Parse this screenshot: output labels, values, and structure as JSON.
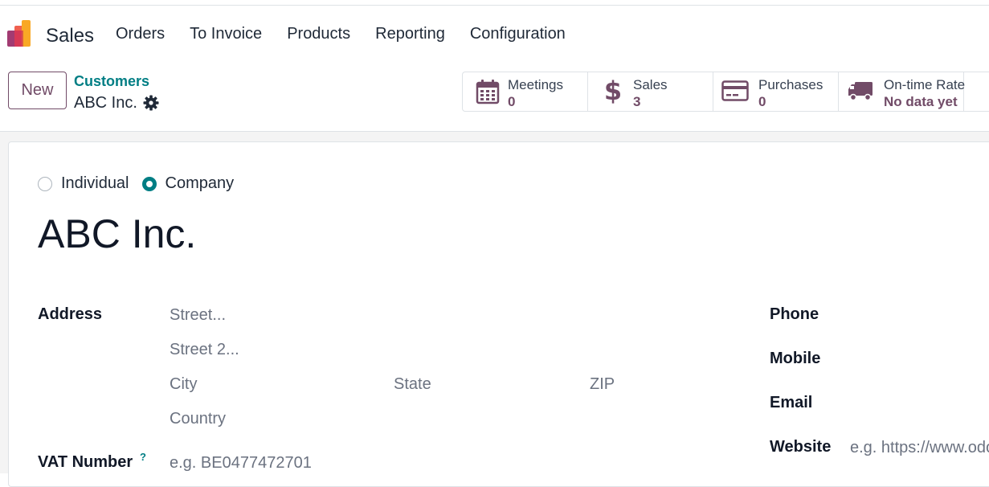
{
  "nav": {
    "app_name": "Sales",
    "menu": [
      "Orders",
      "To Invoice",
      "Products",
      "Reporting",
      "Configuration"
    ]
  },
  "control": {
    "new_label": "New",
    "breadcrumb_parent": "Customers",
    "breadcrumb_current": "ABC Inc."
  },
  "stats": [
    {
      "label": "Meetings",
      "value": "0",
      "icon": "calendar-icon"
    },
    {
      "label": "Sales",
      "value": "3",
      "icon": "dollar-icon"
    },
    {
      "label": "Purchases",
      "value": "0",
      "icon": "credit-card-icon"
    },
    {
      "label": "On-time Rate",
      "value": "No data yet",
      "icon": "truck-icon"
    }
  ],
  "form": {
    "company_type": {
      "individual": "Individual",
      "company": "Company",
      "selected": "Company"
    },
    "name": "ABC Inc.",
    "address_label": "Address",
    "street_ph": "Street...",
    "street2_ph": "Street 2...",
    "city_ph": "City",
    "state_ph": "State",
    "zip_ph": "ZIP",
    "country_ph": "Country",
    "vat_label": "VAT Number",
    "vat_help": "?",
    "vat_ph": "e.g. BE0477472701",
    "phone_label": "Phone",
    "mobile_label": "Mobile",
    "email_label": "Email",
    "website_label": "Website",
    "website_ph": "e.g. https://www.odoo.com"
  },
  "colors": {
    "brand": "#714b67",
    "accent": "#017e84"
  }
}
